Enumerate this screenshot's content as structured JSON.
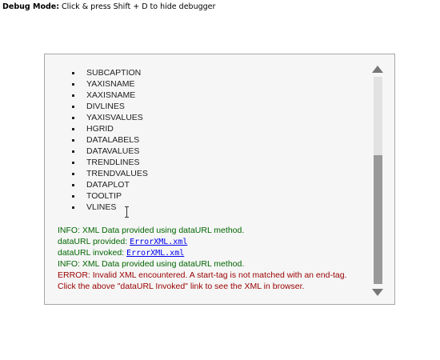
{
  "debugger": {
    "mode_label": "Debug Mode:",
    "hint": " Click & press Shift + D to hide debugger"
  },
  "attributes": [
    "SUBCAPTION",
    "YAXISNAME",
    "XAXISNAME",
    "DIVLINES",
    "YAXISVALUES",
    "HGRID",
    "DATALABELS",
    "DATAVALUES",
    "TRENDLINES",
    "TRENDVALUES",
    "DATAPLOT",
    "TOOLTIP",
    "VLINES"
  ],
  "log": {
    "info1": "INFO: XML Data provided using dataURL method.",
    "provided_label": "dataURL provided: ",
    "provided_link": "ErrorXML.xml",
    "invoked_label": "dataURL invoked: ",
    "invoked_link": "ErrorXML.xml",
    "info2": "INFO: XML Data provided using dataURL method.",
    "error": "ERROR: Invalid XML encountered. A start-tag is not matched with an end-tag.",
    "hint": "Click the above \"dataURL Invoked\" link to see the XML in browser."
  },
  "colors": {
    "info": "#333333",
    "success": "#006600",
    "error": "#990000",
    "link": "#0000ee"
  },
  "scrollbar": {
    "position_fraction": 1.0,
    "visible_fraction": 0.62
  },
  "icons": {
    "scroll_up": "triangle-up-icon",
    "scroll_down": "triangle-down-icon",
    "cursor": "text-cursor-icon"
  }
}
